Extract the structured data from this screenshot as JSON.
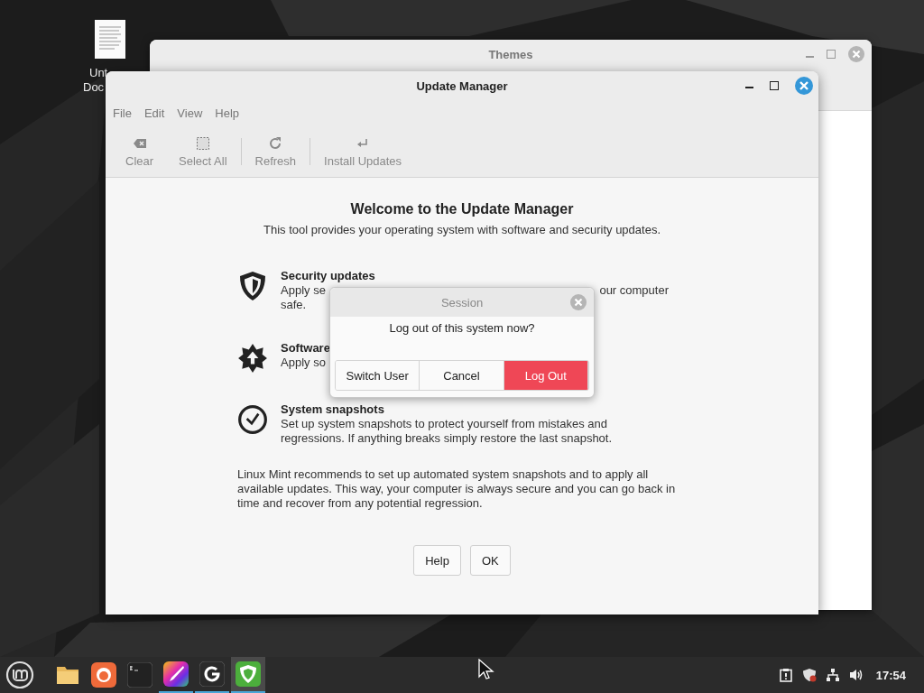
{
  "desktop": {
    "icon_label": [
      "Unt",
      "Doc"
    ]
  },
  "themes_window": {
    "title": "Themes"
  },
  "update_window": {
    "title": "Update Manager",
    "menu": [
      "File",
      "Edit",
      "View",
      "Help"
    ],
    "toolbar": [
      {
        "kind": "clear",
        "label": "Clear"
      },
      {
        "kind": "select",
        "label": "Select All"
      },
      {
        "kind": "refresh",
        "label": "Refresh"
      },
      {
        "kind": "install",
        "label": "Install Updates"
      }
    ],
    "heading": "Welcome to the Update Manager",
    "subtitle": "This tool provides your operating system with software and security updates.",
    "features": [
      {
        "kind": "shield",
        "title": "Security updates",
        "lines": [
          [
            "Apply se",
            "our computer"
          ],
          [
            "safe."
          ]
        ]
      },
      {
        "kind": "star",
        "title": "Software",
        "lines": [
          [
            "Apply so"
          ]
        ]
      },
      {
        "kind": "clock",
        "title": "System snapshots",
        "lines": [
          [
            "Set up system snapshots to protect yourself from mistakes and"
          ],
          [
            "regressions. If anything breaks simply restore the last snapshot."
          ]
        ]
      }
    ],
    "note": "Linux Mint recommends to set up automated system snapshots and to apply all available updates. This way, your computer is always secure and you can go back in time and recover from any potential regression.",
    "buttons": [
      "Help",
      "OK"
    ]
  },
  "dialog": {
    "title": "Session",
    "message": "Log out of this system now?",
    "buttons": [
      {
        "label": "Switch User",
        "kind": "plain"
      },
      {
        "label": "Cancel",
        "kind": "plain"
      },
      {
        "label": "Log Out",
        "kind": "destructive"
      }
    ]
  },
  "taskbar": {
    "apps": [
      {
        "kind": "folder",
        "running": false,
        "selected": false
      },
      {
        "kind": "browser",
        "running": false,
        "selected": false
      },
      {
        "kind": "terminal",
        "running": false,
        "selected": false
      },
      {
        "kind": "paint",
        "running": true,
        "selected": false
      },
      {
        "kind": "snapshot",
        "running": true,
        "selected": false
      },
      {
        "kind": "shield",
        "running": true,
        "selected": true
      }
    ],
    "clock": "17:54"
  }
}
